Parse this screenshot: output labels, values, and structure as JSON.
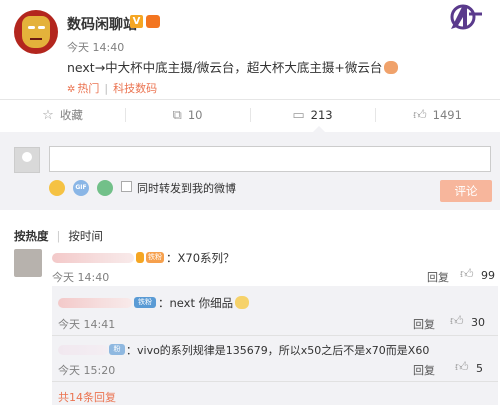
{
  "post": {
    "author": "数码闲聊站",
    "verified_badge": "V",
    "time": "今天 14:40",
    "source": "",
    "text": "next→中大杯中底主摄/微云台，超大杯大底主摄+微云台",
    "tags": [
      "热门",
      "科技数码"
    ]
  },
  "actions": {
    "favorite": "收藏",
    "repost": "10",
    "comment": "213",
    "like": "1491"
  },
  "composer": {
    "placeholder": "",
    "gif_label": "GIF",
    "checkbox_label": "同时转发到我的微博",
    "submit": "评论"
  },
  "sort": {
    "hot": "按热度",
    "time": "按时间"
  },
  "comments": [
    {
      "badge": "铁粉",
      "text": "：X70系列？",
      "time": "今天 14:40",
      "reply": "回复",
      "likes": "99",
      "replies": [
        {
          "badge": "铁粉",
          "text": "：next 你细品",
          "time": "今天 14:41",
          "reply": "回复",
          "likes": "30"
        },
        {
          "badge": "粉",
          "text": "：vivo的系列规律是135679，所以x50之后不是x70而是X60",
          "time": "今天 15:20",
          "reply": "回复",
          "likes": "5"
        }
      ],
      "more": "共14条回复"
    }
  ],
  "colors": {
    "accent": "#eb7350",
    "submit_disabled": "#f7b69c",
    "panel": "#f2f2f5"
  },
  "icons": [
    "star-icon",
    "repost-icon",
    "comment-icon",
    "thumbs-up-icon",
    "emoji-icon",
    "gif-icon",
    "image-icon",
    "avengers-logo"
  ]
}
